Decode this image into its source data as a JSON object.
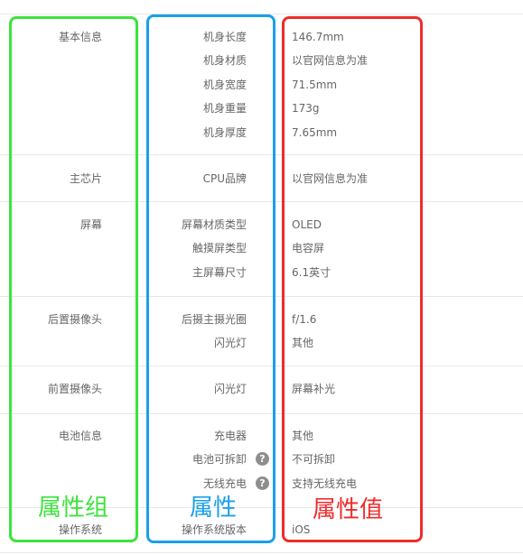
{
  "groups": [
    {
      "label": "基本信息",
      "rows": [
        {
          "name": "机身长度",
          "value": "146.7mm"
        },
        {
          "name": "机身材质",
          "value": "以官网信息为准"
        },
        {
          "name": "机身宽度",
          "value": "71.5mm"
        },
        {
          "name": "机身重量",
          "value": "173g"
        },
        {
          "name": "机身厚度",
          "value": "7.65mm"
        }
      ]
    },
    {
      "label": "主芯片",
      "rows": [
        {
          "name": "CPU品牌",
          "value": "以官网信息为准"
        }
      ]
    },
    {
      "label": "屏幕",
      "rows": [
        {
          "name": "屏幕材质类型",
          "value": "OLED"
        },
        {
          "name": "触摸屏类型",
          "value": "电容屏"
        },
        {
          "name": "主屏幕尺寸",
          "value": "6.1英寸"
        }
      ]
    },
    {
      "label": "后置摄像头",
      "rows": [
        {
          "name": "后摄主摄光圈",
          "value": "f/1.6"
        },
        {
          "name": "闪光灯",
          "value": "其他"
        }
      ]
    },
    {
      "label": "前置摄像头",
      "rows": [
        {
          "name": "闪光灯",
          "value": "屏幕补光"
        }
      ]
    },
    {
      "label": "电池信息",
      "rows": [
        {
          "name": "充电器",
          "value": "其他"
        },
        {
          "name": "电池可拆卸",
          "value": "不可拆卸"
        },
        {
          "name": "无线充电",
          "value": "支持无线充电"
        }
      ]
    },
    {
      "label": "操作系统",
      "rows": [
        {
          "name": "操作系统版本",
          "value": "iOS"
        }
      ]
    }
  ],
  "help_icon_glyph": "?",
  "overlay": {
    "group_label": "属性组",
    "attr_label": "属性",
    "value_label": "属性值"
  }
}
